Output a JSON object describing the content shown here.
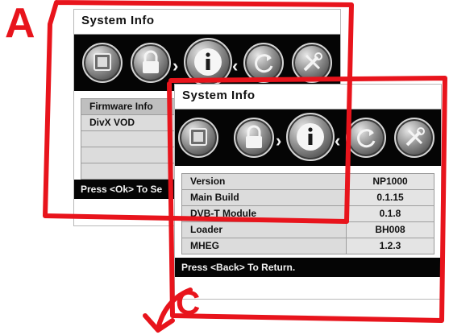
{
  "panel_a": {
    "title": "System Info",
    "menu": [
      "Firmware Info",
      "DivX VOD"
    ],
    "footer": "Press <Ok> To Se"
  },
  "panel_b": {
    "title": "System Info",
    "rows": [
      {
        "label": "Version",
        "value": "NP1000"
      },
      {
        "label": "Main Build",
        "value": "0.1.15"
      },
      {
        "label": "DVB-T Module",
        "value": "0.1.8"
      },
      {
        "label": "Loader",
        "value": "BH008"
      },
      {
        "label": "MHEG",
        "value": "1.2.3"
      }
    ],
    "footer": "Press <Back> To Return."
  },
  "icons": [
    "monitor-icon",
    "lock-icon",
    "info-icon",
    "refresh-icon",
    "tools-icon"
  ],
  "annotations": {
    "label_a": "A",
    "label_c": "C",
    "color": "#e8141c"
  }
}
